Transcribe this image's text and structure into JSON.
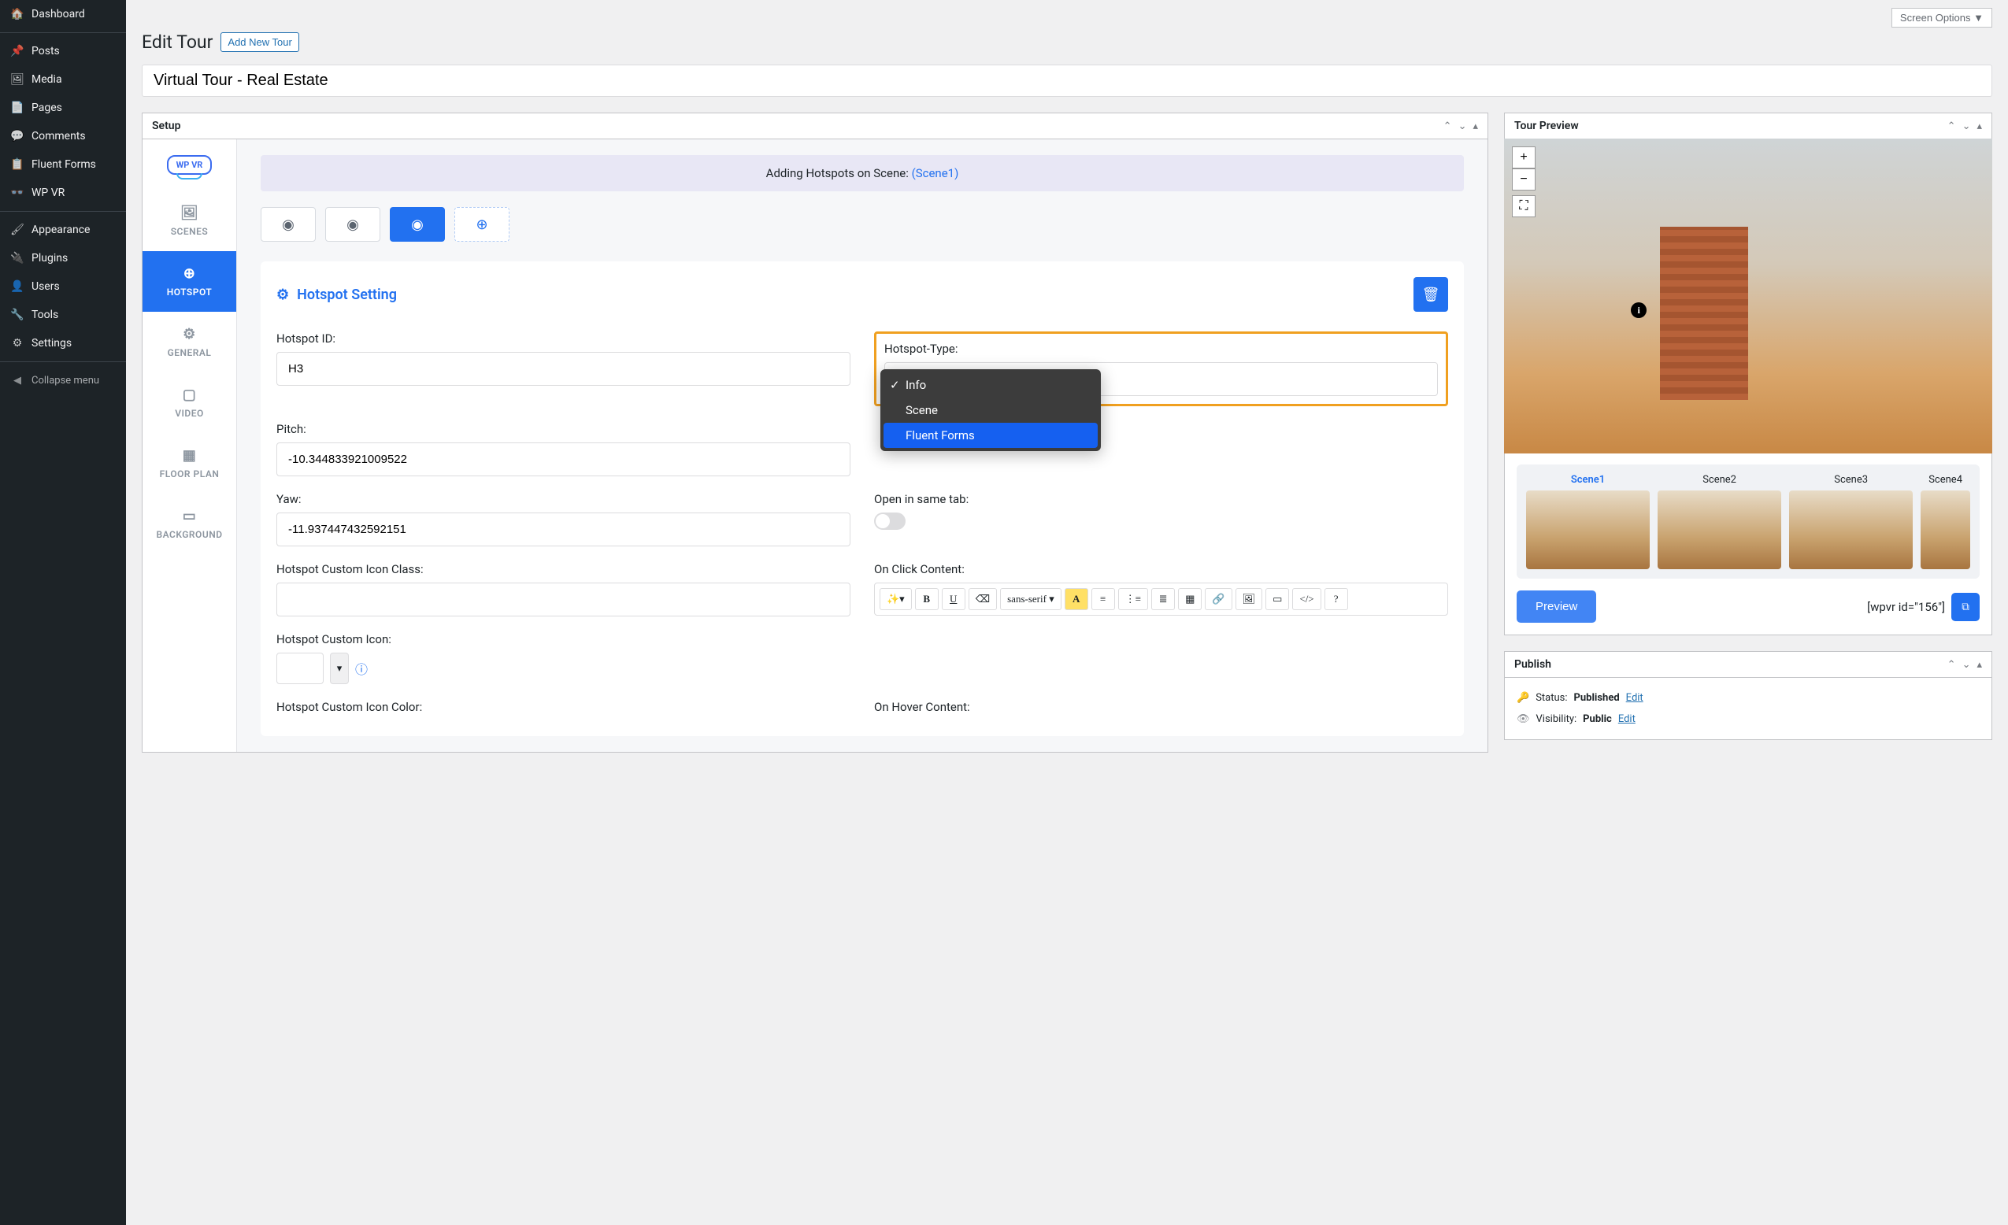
{
  "sidebar": {
    "items": [
      {
        "label": "Dashboard",
        "icon": "🏠"
      },
      {
        "label": "Posts",
        "icon": "📌"
      },
      {
        "label": "Media",
        "icon": "🖼"
      },
      {
        "label": "Pages",
        "icon": "📄"
      },
      {
        "label": "Comments",
        "icon": "💬"
      },
      {
        "label": "Fluent Forms",
        "icon": "📋"
      },
      {
        "label": "WP VR",
        "icon": "👓"
      },
      {
        "label": "Appearance",
        "icon": "🖌"
      },
      {
        "label": "Plugins",
        "icon": "🔌"
      },
      {
        "label": "Users",
        "icon": "👤"
      },
      {
        "label": "Tools",
        "icon": "🔧"
      },
      {
        "label": "Settings",
        "icon": "⚙"
      }
    ],
    "collapse": "Collapse menu"
  },
  "header": {
    "screen_options": "Screen Options ▼",
    "page_title": "Edit Tour",
    "add_new": "Add New Tour",
    "tour_title": "Virtual Tour - Real Estate"
  },
  "setup": {
    "box_title": "Setup",
    "logo_text": "WP VR",
    "tabs": [
      {
        "label": "SCENES",
        "icon": "🖼"
      },
      {
        "label": "HOTSPOT",
        "icon": "⊕",
        "active": true
      },
      {
        "label": "GENERAL",
        "icon": "⚙"
      },
      {
        "label": "VIDEO",
        "icon": "▢"
      },
      {
        "label": "FLOOR PLAN",
        "icon": "▦"
      },
      {
        "label": "BACKGROUND",
        "icon": "▭"
      }
    ],
    "banner_prefix": "Adding Hotspots on Scene: ",
    "banner_scene": "(Scene1)",
    "setting_title": "Hotspot Setting",
    "fields": {
      "hotspot_id_label": "Hotspot ID:",
      "hotspot_id_value": "H3",
      "hotspot_type_label": "Hotspot-Type:",
      "pitch_label": "Pitch:",
      "pitch_value": "-10.344833921009522",
      "yaw_label": "Yaw:",
      "yaw_value": "-11.937447432592151",
      "same_tab_label": "Open in same tab:",
      "onclick_label": "On Click Content:",
      "custom_class_label": "Hotspot Custom Icon Class:",
      "custom_icon_label": "Hotspot Custom Icon:",
      "custom_color_label": "Hotspot Custom Icon Color:",
      "onhover_label": "On Hover Content:"
    },
    "dropdown": {
      "options": [
        "Info",
        "Scene",
        "Fluent Forms"
      ],
      "checked": "Info",
      "hover": "Fluent Forms"
    },
    "editor": {
      "font": "sans-serif"
    }
  },
  "preview": {
    "box_title": "Tour Preview",
    "scenes": [
      "Scene1",
      "Scene2",
      "Scene3",
      "Scene4"
    ],
    "preview_btn": "Preview",
    "shortcode": "[wpvr id=\"156\"]"
  },
  "publish": {
    "box_title": "Publish",
    "status_label": "Status:",
    "status_value": "Published",
    "visibility_label": "Visibility:",
    "visibility_value": "Public",
    "edit": "Edit"
  }
}
